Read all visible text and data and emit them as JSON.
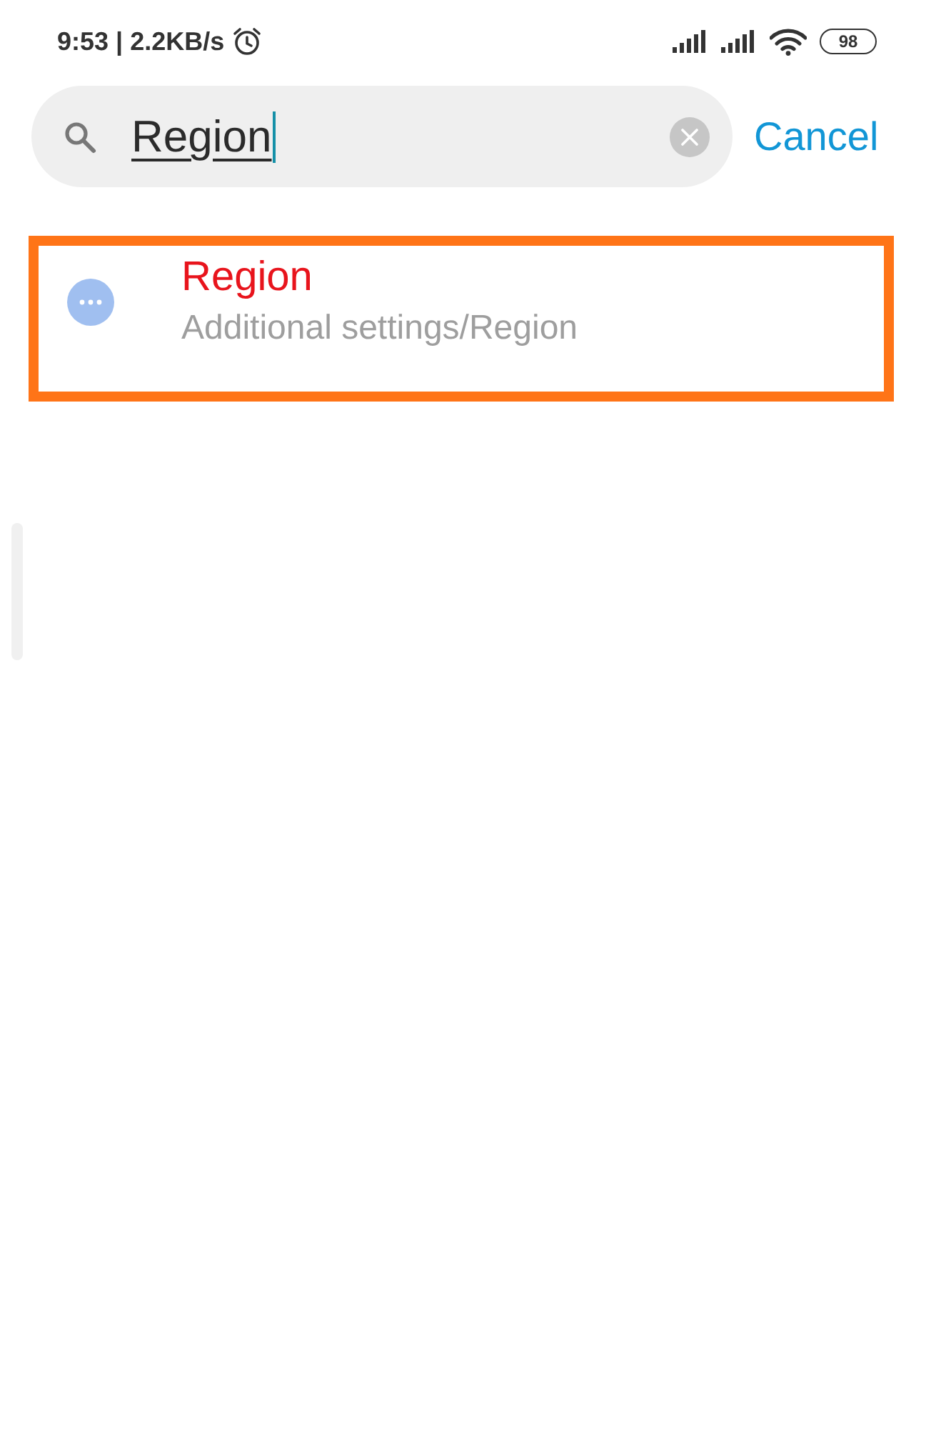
{
  "status_bar": {
    "text": "9:53 | 2.2KB/s",
    "battery": "98"
  },
  "search": {
    "value": "Region",
    "composing": true,
    "focused": true
  },
  "cancel": "Cancel",
  "results": [
    {
      "title": "Region",
      "path": "Additional settings/Region",
      "highlighted": true
    }
  ]
}
